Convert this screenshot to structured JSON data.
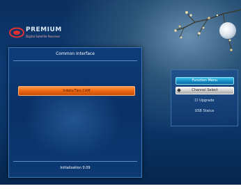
{
  "logo": {
    "name": "PREMIUM",
    "tagline": "Digital Satellite Receiver"
  },
  "main_panel": {
    "title": "Common Interface",
    "cam_item": "Irdeto/Tips CAM",
    "footer": "Initialization 0.09"
  },
  "side_menu": {
    "items": [
      {
        "label": "Function Menu",
        "state": "active"
      },
      {
        "label": "Channel Select",
        "state": "selected"
      },
      {
        "label": "CI Upgrade",
        "state": "normal"
      },
      {
        "label": "USB Status",
        "state": "normal"
      }
    ]
  },
  "colors": {
    "background": "#0b3366",
    "highlight_orange": "#f06a14",
    "active_blue": "#1289c2",
    "selected_gray": "#c8c8c8"
  }
}
